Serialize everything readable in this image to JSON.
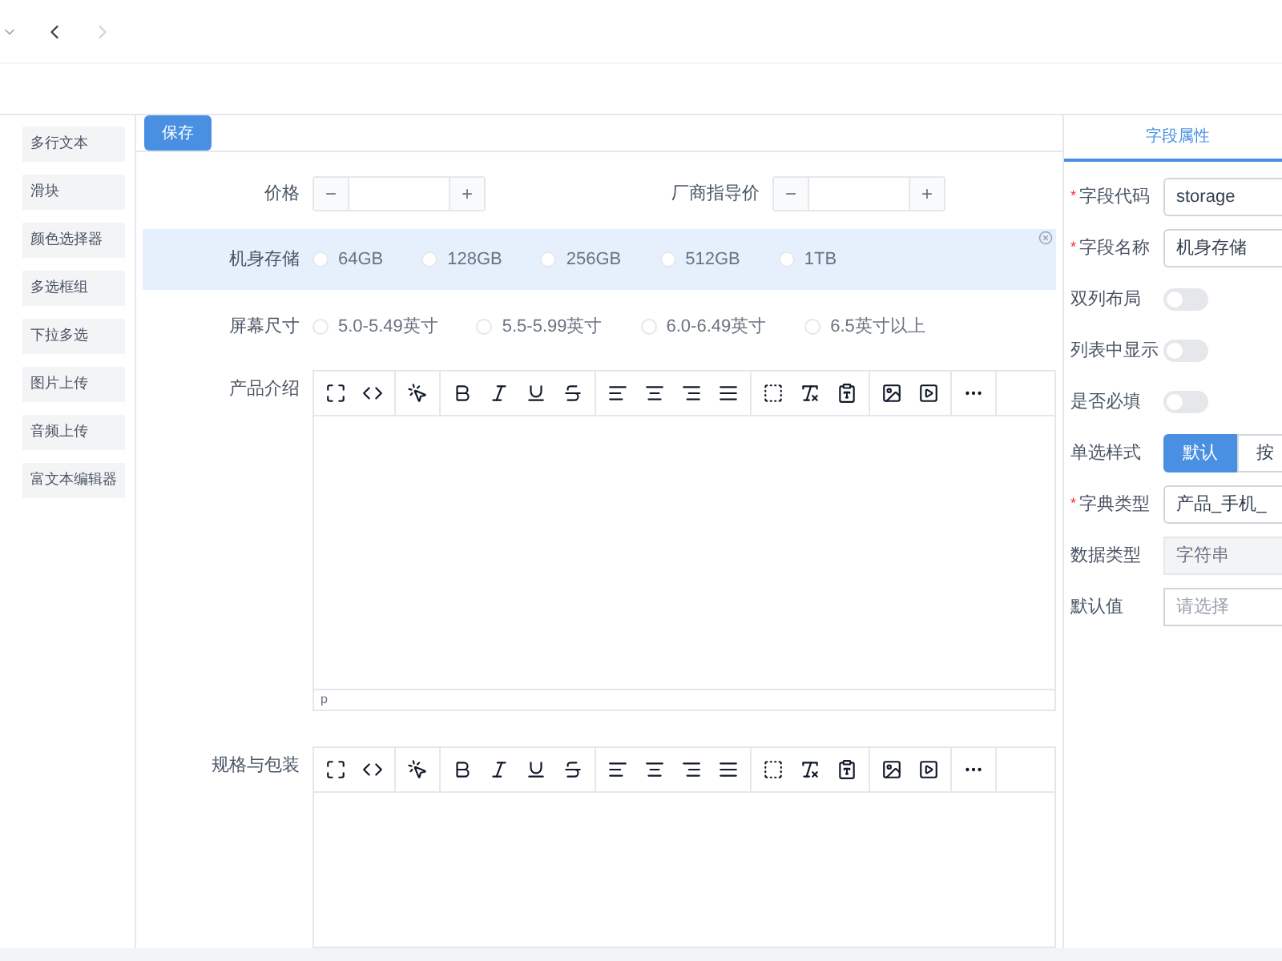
{
  "sidebar": {
    "items": [
      {
        "label": "多行文本"
      },
      {
        "label": "滑块"
      },
      {
        "label": "颜色选择器"
      },
      {
        "label": "多选框组"
      },
      {
        "label": "下拉多选"
      },
      {
        "label": "图片上传"
      },
      {
        "label": "音频上传"
      },
      {
        "label": "富文本编辑器"
      }
    ]
  },
  "toolbar": {
    "save_button": "保存"
  },
  "form": {
    "price_row": [
      {
        "label": "价格",
        "minus": "−",
        "plus": "+"
      },
      {
        "label": "厂商指导价",
        "minus": "−",
        "plus": "+"
      }
    ],
    "storage": {
      "label": "机身存储",
      "highlighted": true,
      "options": [
        {
          "label": "64GB",
          "selected": false
        },
        {
          "label": "128GB",
          "selected": false
        },
        {
          "label": "256GB",
          "selected": false
        },
        {
          "label": "512GB",
          "selected": false
        },
        {
          "label": "1TB",
          "selected": false
        }
      ]
    },
    "screen": {
      "label": "屏幕尺寸",
      "highlighted": false,
      "options": [
        {
          "label": "5.0-5.49英寸",
          "selected": false
        },
        {
          "label": "5.5-5.99英寸",
          "selected": false
        },
        {
          "label": "6.0-6.49英寸",
          "selected": false
        },
        {
          "label": "6.5英寸以上",
          "selected": false
        }
      ]
    },
    "editors": [
      {
        "label": "产品介绍",
        "status": "p"
      },
      {
        "label": "规格与包装"
      }
    ]
  },
  "properties": {
    "tab": "字段属性",
    "rows": [
      {
        "kind": "input",
        "label": "字段代码",
        "required_mark": "*",
        "value": "storage"
      },
      {
        "kind": "input",
        "label": "字段名称",
        "required_mark": "*",
        "value": "机身存储"
      },
      {
        "kind": "switch",
        "label": "双列布局",
        "on": false
      },
      {
        "kind": "switch",
        "label": "列表中显示",
        "on": false
      },
      {
        "kind": "switch",
        "label": "是否必填",
        "on": false
      },
      {
        "kind": "segmented",
        "label": "单选样式",
        "options": [
          {
            "label": "默认",
            "selected": true
          },
          {
            "label": "按",
            "selected": false
          }
        ]
      },
      {
        "kind": "input",
        "label": "字典类型",
        "required_mark": "*",
        "value": "产品_手机_"
      },
      {
        "kind": "disabled",
        "label": "数据类型",
        "placeholder": "字符串"
      },
      {
        "kind": "select",
        "label": "默认值",
        "placeholder": "请选择"
      }
    ]
  }
}
